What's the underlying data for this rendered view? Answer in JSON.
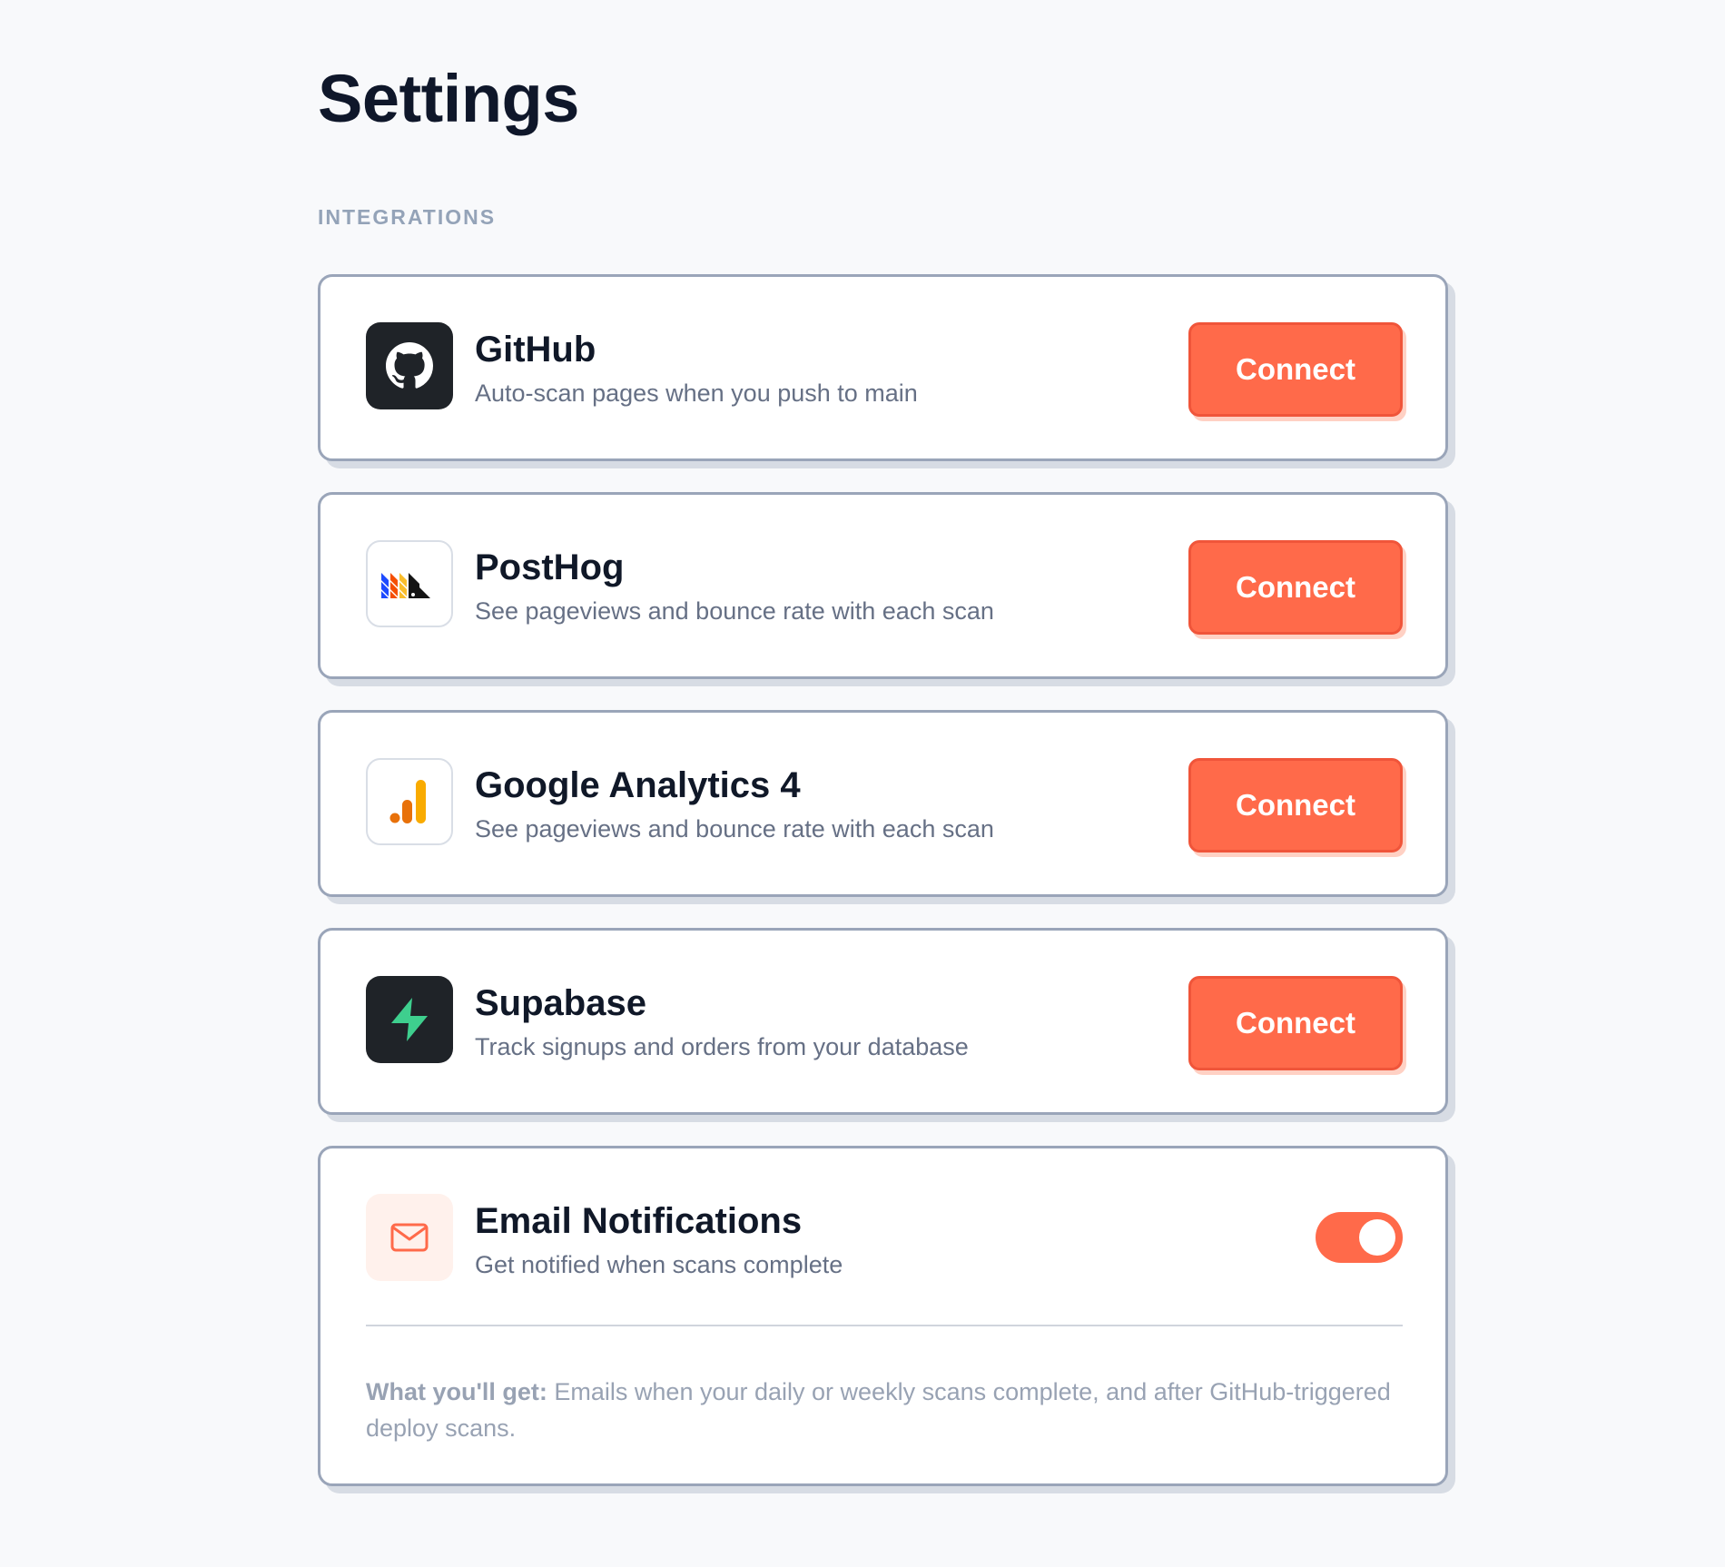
{
  "page": {
    "title": "Settings",
    "section_label": "INTEGRATIONS"
  },
  "integrations": [
    {
      "name": "GitHub",
      "description": "Auto-scan pages when you push to main",
      "button_label": "Connect",
      "icon": "github-icon"
    },
    {
      "name": "PostHog",
      "description": "See pageviews and bounce rate with each scan",
      "button_label": "Connect",
      "icon": "posthog-icon"
    },
    {
      "name": "Google Analytics 4",
      "description": "See pageviews and bounce rate with each scan",
      "button_label": "Connect",
      "icon": "google-analytics-icon"
    },
    {
      "name": "Supabase",
      "description": "Track signups and orders from your database",
      "button_label": "Connect",
      "icon": "supabase-icon"
    }
  ],
  "email_notifications": {
    "name": "Email Notifications",
    "description": "Get notified when scans complete",
    "icon": "mail-icon",
    "enabled": true,
    "note_label": "What you'll get:",
    "note_text": " Emails when your daily or weekly scans complete, and after GitHub-triggered deploy scans."
  },
  "colors": {
    "accent": "#ff6a4a",
    "background": "#f8f9fb",
    "card_border": "#9aa5b9"
  }
}
